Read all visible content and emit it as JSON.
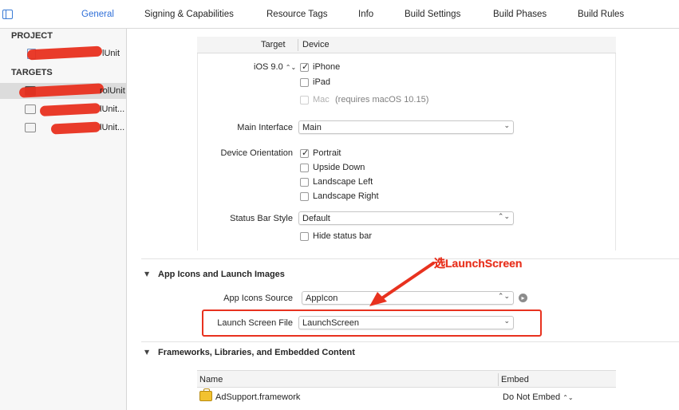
{
  "tabs": [
    {
      "label": "General",
      "active": true
    },
    {
      "label": "Signing & Capabilities"
    },
    {
      "label": "Resource Tags"
    },
    {
      "label": "Info"
    },
    {
      "label": "Build Settings"
    },
    {
      "label": "Build Phases"
    },
    {
      "label": "Build Rules"
    }
  ],
  "sidebar": {
    "project_header": "PROJECT",
    "project_item": "lUnit",
    "targets_header": "TARGETS",
    "targets": [
      {
        "label": "rolUnit",
        "selected": true,
        "icon": "app-icon"
      },
      {
        "label": "lUnit...",
        "icon": "folder-icon"
      },
      {
        "label": "lUnit...",
        "icon": "folder-icon"
      }
    ]
  },
  "deployment": {
    "col_target": "Target",
    "col_device": "Device",
    "ios_version": "iOS 9.0",
    "stepper_glyph": "⌃⌄",
    "devices": [
      {
        "label": "iPhone",
        "checked": true
      },
      {
        "label": "iPad",
        "checked": false
      },
      {
        "label": "Mac",
        "checked": false,
        "disabled": true,
        "note": "(requires macOS 10.15)"
      }
    ],
    "main_interface_label": "Main Interface",
    "main_interface_value": "Main",
    "orientation_label": "Device Orientation",
    "orientations": [
      {
        "label": "Portrait",
        "checked": true
      },
      {
        "label": "Upside Down",
        "checked": false
      },
      {
        "label": "Landscape Left",
        "checked": false
      },
      {
        "label": "Landscape Right",
        "checked": false
      }
    ],
    "status_bar_label": "Status Bar Style",
    "status_bar_value": "Default",
    "hide_status_bar": {
      "label": "Hide status bar",
      "checked": false
    }
  },
  "app_icons": {
    "section_title": "App Icons and Launch Images",
    "source_label": "App Icons Source",
    "source_value": "AppIcon",
    "launch_label": "Launch Screen File",
    "launch_value": "LaunchScreen"
  },
  "annotation": {
    "text": "选LaunchScreen",
    "color": "#e8321f"
  },
  "frameworks": {
    "section_title": "Frameworks, Libraries, and Embedded Content",
    "col_name": "Name",
    "col_embed": "Embed",
    "rows": [
      {
        "name": "AdSupport.framework",
        "embed": "Do Not Embed"
      }
    ]
  },
  "colors": {
    "accent": "#2f6fd8",
    "annotation_red": "#e8321f",
    "sidebar_bg": "#f7f7f7"
  }
}
